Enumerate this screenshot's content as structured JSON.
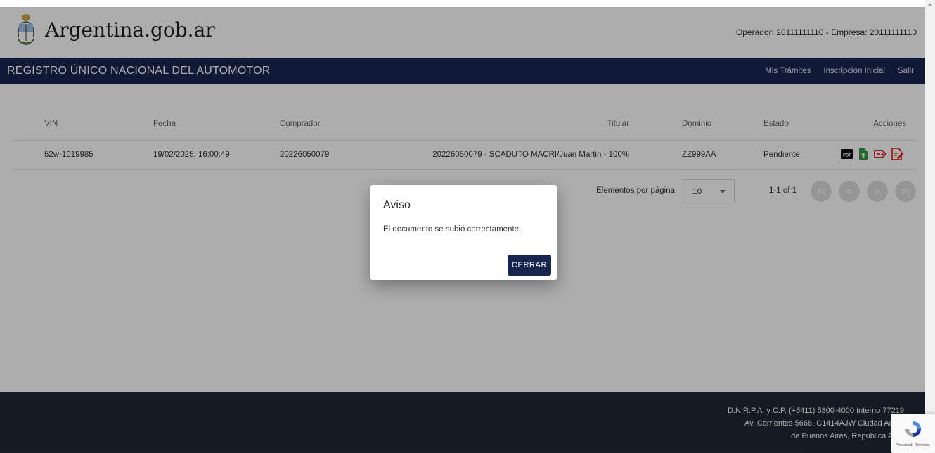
{
  "header": {
    "brand": "Argentina.gob.ar",
    "operator": "Operador: 20111111110 - Empresa: 20111111110",
    "logo_icon": "coat-of-arms-icon"
  },
  "navbar": {
    "title": "REGISTRO ÚNICO NACIONAL DEL AUTOMOTOR",
    "links": [
      "Mis Trámites",
      "Inscripción Inicial",
      "Salir"
    ],
    "background": "#18264f"
  },
  "table": {
    "columns": {
      "vin": "VIN",
      "fecha": "Fecha",
      "comprador": "Comprador",
      "titular": "Titular",
      "dominio": "Dominio",
      "estado": "Estado",
      "acciones": "Acciones"
    },
    "rows": [
      {
        "vin": "52w-1019985",
        "fecha": "19/02/2025, 16:00:49",
        "comprador": "20226050079",
        "titular": "20226050079 - SCADUTO MACRI/Juan Martin - 100%",
        "dominio": "ZZ999AA",
        "estado": "Pendiente",
        "actions": [
          "pdf-icon",
          "upload-file-icon",
          "tag-icon",
          "edit-document-icon"
        ]
      }
    ]
  },
  "pager": {
    "label": "Elementos por página",
    "page_size": "10",
    "range": "1-1 of 1",
    "buttons": [
      "first-page-icon",
      "previous-page-icon",
      "next-page-icon",
      "last-page-icon"
    ]
  },
  "modal": {
    "title": "Aviso",
    "message": "El documento se subió correctamente.",
    "button": "CERRAR"
  },
  "footer": {
    "lines": [
      "D.N.R.P.A. y C.P. (+5411) 5300-4000 Interno 77219",
      "Av. Corrientes 5666, C1414AJW Ciudad Autón",
      "de Buenos Aires, República Arge"
    ]
  },
  "recaptcha": {
    "text": "Privacidad - Términos"
  },
  "colors": {
    "accent": "#18264f",
    "footer": "#1e2936",
    "pdf": "#111111",
    "upload": "#2e9b3c",
    "danger": "#e02f2f"
  }
}
